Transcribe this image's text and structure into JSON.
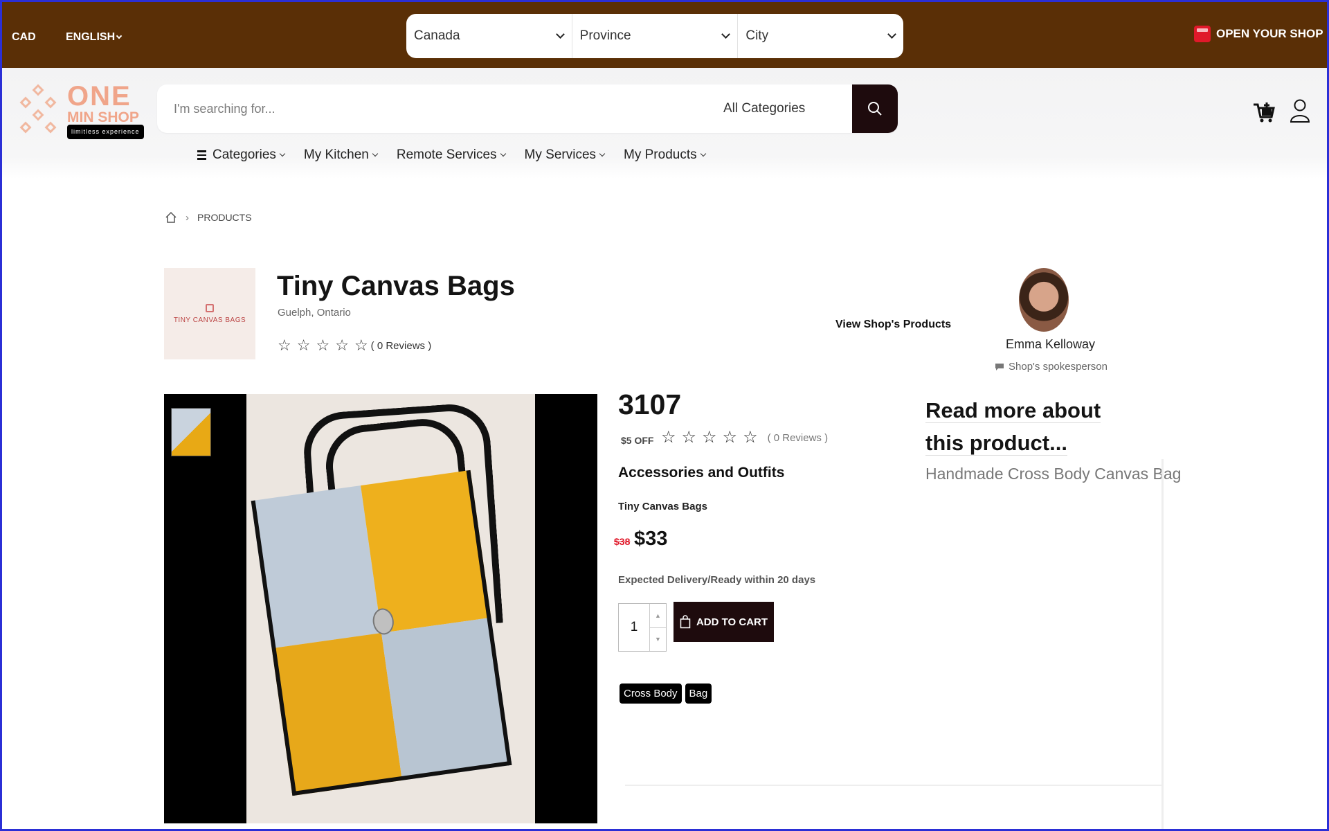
{
  "topbar": {
    "currency": "CAD",
    "language": "ENGLISH",
    "country": "Canada",
    "province": "Province",
    "city": "City",
    "open_shop": "OPEN YOUR SHOP"
  },
  "header": {
    "logo": {
      "line1": "ONE",
      "line2": "MIN SHOP",
      "tagline": "limitless experience"
    },
    "search_placeholder": "I'm searching for...",
    "search_category": "All Categories"
  },
  "menu": {
    "items": [
      {
        "label": "Categories"
      },
      {
        "label": "My Kitchen"
      },
      {
        "label": "Remote Services"
      },
      {
        "label": "My Services"
      },
      {
        "label": "My Products"
      }
    ]
  },
  "breadcrumb": {
    "current": "PRODUCTS"
  },
  "shop": {
    "logo_text": "TINY CANVAS BAGS",
    "title": "Tiny Canvas Bags",
    "location": "Guelph, Ontario",
    "reviews": "( 0 Reviews )",
    "view_products": "View Shop's Products",
    "spokesperson_name": "Emma Kelloway",
    "spokesperson_role": "Shop's spokesperson"
  },
  "product": {
    "code": "3107",
    "discount": "$5 OFF",
    "reviews": "( 0 Reviews )",
    "category": "Accessories and Outfits",
    "shop_name": "Tiny Canvas Bags",
    "old_price": "$38",
    "price": "$33",
    "delivery": "Expected Delivery/Ready within 20 days",
    "quantity": "1",
    "add_to_cart": "ADD TO CART",
    "tags": [
      "Cross Body",
      "Bag"
    ],
    "read_more": "Read more about this product...",
    "description": "Handmade Cross Body Canvas Bag"
  },
  "colors": {
    "topbar_bg": "#5a2f06",
    "dark_button": "#1e0b0d",
    "sale_red": "#e0192a",
    "logo_peach": "#f0a58a",
    "frame_blue": "#2b2fd6"
  },
  "icons": {
    "topbar": [
      "chevron-down-icon",
      "shop-icon"
    ],
    "header": [
      "search-icon",
      "cart-icon",
      "user-icon",
      "menu-icon"
    ],
    "misc": [
      "home-icon",
      "star-icon",
      "chat-icon",
      "shopping-bag-icon"
    ]
  }
}
